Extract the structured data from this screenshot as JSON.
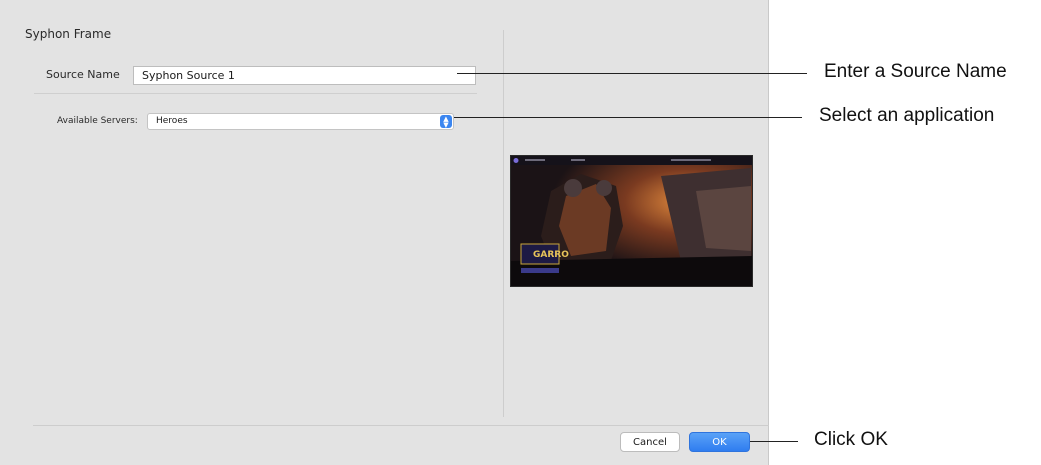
{
  "dialog": {
    "section_title": "Syphon Frame",
    "source_name_label": "Source Name",
    "source_name_value": "Syphon Source 1",
    "available_servers_label": "Available Servers:",
    "available_servers_value": "Heroes",
    "preview_logo_text": "GARRO",
    "cancel_label": "Cancel",
    "ok_label": "OK"
  },
  "annotations": {
    "source_name": "Enter a Source Name",
    "servers": "Select an application",
    "ok": "Click OK"
  },
  "colors": {
    "dialog_background": "#e3e3e3",
    "accent": "#3b86f0"
  },
  "icons": {
    "select_stepper": "up-down-chevron-icon"
  }
}
